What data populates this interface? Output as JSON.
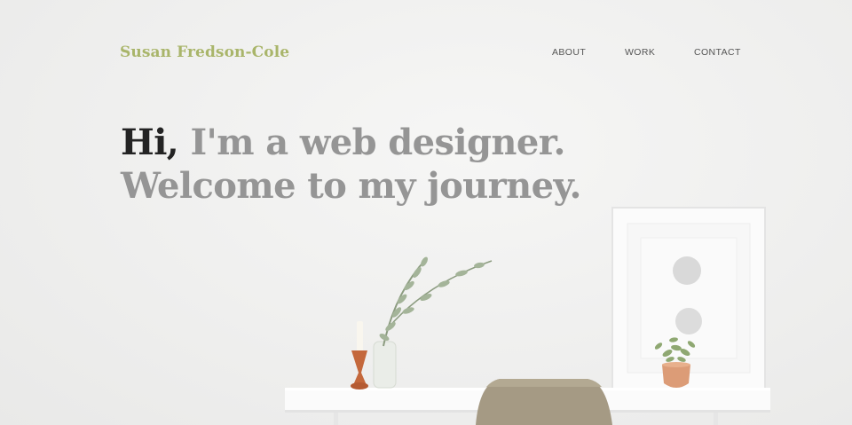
{
  "header": {
    "brand": "Susan Fredson-Cole",
    "nav": [
      {
        "label": "ABOUT"
      },
      {
        "label": "WORK"
      },
      {
        "label": "CONTACT"
      }
    ]
  },
  "hero": {
    "greeting": "Hi,",
    "line1_rest": " I'm a web designer.",
    "line2": "Welcome to my journey."
  },
  "colors": {
    "brand": "#a9b56a",
    "headline_dark": "#232323",
    "headline_gray": "#959595",
    "background": "#f0f0ef"
  },
  "photo": {
    "subject": "white desk with olive chair, plant vase, candle holder, framed print"
  }
}
